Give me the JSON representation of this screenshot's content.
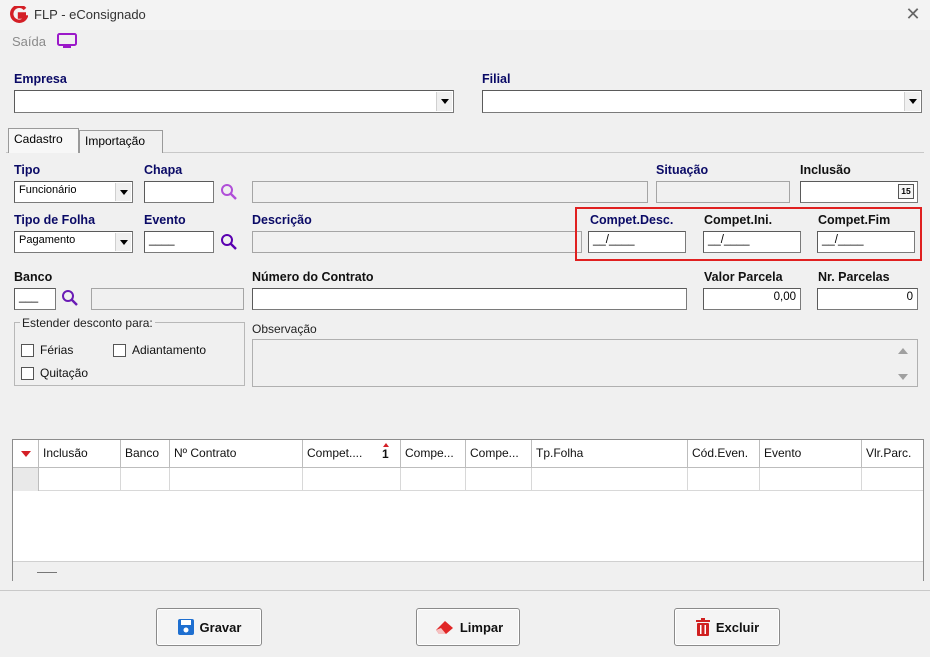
{
  "window": {
    "title": "FLP - eConsignado"
  },
  "menu": {
    "exit_label": "Saída"
  },
  "empresa": {
    "label": "Empresa",
    "value": ""
  },
  "filial": {
    "label": "Filial",
    "value": ""
  },
  "tabs": [
    {
      "label": "Cadastro"
    },
    {
      "label": "Importação"
    }
  ],
  "form": {
    "tipo": {
      "label": "Tipo",
      "value": "Funcionário"
    },
    "chapa": {
      "label": "Chapa",
      "value": ""
    },
    "situacao": {
      "label": "Situação",
      "value": ""
    },
    "inclusao": {
      "label": "Inclusão",
      "value": "",
      "calendar_day": "15"
    },
    "tipo_folha": {
      "label": "Tipo de Folha",
      "value": "Pagamento"
    },
    "evento": {
      "label": "Evento",
      "value": "____"
    },
    "descricao": {
      "label": "Descrição",
      "value": ""
    },
    "compet_desc": {
      "label": "Compet.Desc.",
      "value": "__/____"
    },
    "compet_ini": {
      "label": "Compet.Ini.",
      "value": "__/____"
    },
    "compet_fim": {
      "label": "Compet.Fim",
      "value": "__/____"
    },
    "banco": {
      "label": "Banco",
      "value": "___"
    },
    "numero_contrato": {
      "label": "Número do Contrato",
      "value": ""
    },
    "valor_parcela": {
      "label": "Valor Parcela",
      "value": "0,00"
    },
    "nr_parcelas": {
      "label": "Nr. Parcelas",
      "value": "0"
    },
    "estender": {
      "title": "Estender desconto para:",
      "ferias": "Férias",
      "adiantamento": "Adiantamento",
      "quitacao": "Quitação"
    },
    "observacao": {
      "label": "Observação",
      "value": ""
    }
  },
  "grid": {
    "columns": [
      "Inclusão",
      "Banco",
      "Nº Contrato",
      "Compet....",
      "Compe...",
      "Compe...",
      "Tp.Folha",
      "Cód.Even.",
      "Evento",
      "Vlr.Parc."
    ],
    "sort_indicator": "1"
  },
  "buttons": {
    "save": "Gravar",
    "clear": "Limpar",
    "delete": "Excluir"
  },
  "colors": {
    "label_blue": "#0a0a66",
    "highlight_red": "#e02020",
    "save_icon": "#1e6fd0",
    "delete_icon": "#d02020"
  }
}
